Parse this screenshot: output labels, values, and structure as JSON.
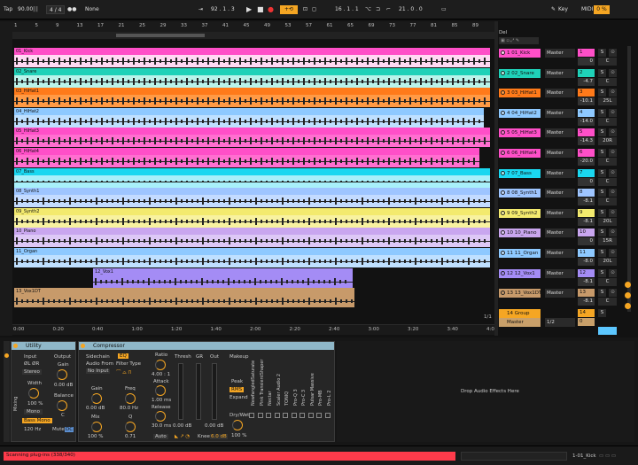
{
  "transport": {
    "tap": "Tap",
    "tempo": "90.00",
    "sig": "4 / 4",
    "metro": "●●",
    "none": "None",
    "pos": "92 .  1 .  3",
    "loop_start": "16 .  1 .  1",
    "loop_len": "21 .  0 .  0",
    "key": "Key",
    "midi": "MIDI",
    "cpu": "0 %"
  },
  "ruler": {
    "bars": [
      "1",
      "5",
      "9",
      "13",
      "17",
      "21",
      "25",
      "29",
      "33",
      "37",
      "41",
      "45",
      "49",
      "53",
      "57",
      "61",
      "65",
      "69",
      "73",
      "77",
      "81",
      "85",
      "89"
    ],
    "times": [
      "0:00",
      "0:20",
      "0:40",
      "1:00",
      "1:20",
      "1:40",
      "2:00",
      "2:20",
      "2:40",
      "3:00",
      "3:20",
      "3:40",
      "4:00"
    ],
    "page": "1/1"
  },
  "tracks": [
    {
      "name": "01_Kick",
      "mix": "1 01_Kick",
      "num": "1",
      "vol": "0",
      "pan": "C",
      "color": "#ff4fc8",
      "light": "#ffd9f3"
    },
    {
      "name": "02_Snare",
      "mix": "2 02_Snare",
      "num": "2",
      "vol": "-4.7",
      "pan": "C",
      "color": "#1fd1b8",
      "light": "#b9f3ea"
    },
    {
      "name": "03_HiHat1",
      "mix": "3 03_HiHat1",
      "num": "3",
      "vol": "-10.1",
      "pan": "25L",
      "color": "#ff7a1a",
      "light": "#ff9a45"
    },
    {
      "name": "04_HiHat2",
      "mix": "4 04_HiHat2",
      "num": "4",
      "vol": "-14.0",
      "pan": "C",
      "color": "#8ec9ff",
      "light": "#bfe0ff"
    },
    {
      "name": "05_HiHat3",
      "mix": "5 05_HiHat3",
      "num": "5",
      "vol": "-14.3",
      "pan": "20R",
      "color": "#ff4fc8",
      "light": "#ff6fd0"
    },
    {
      "name": "06_HiHat4",
      "mix": "6 06_HiHat4",
      "num": "6",
      "vol": "-20.0",
      "pan": "C",
      "color": "#ff4fc8",
      "light": "#ff6fd0"
    },
    {
      "name": "07_Bass",
      "mix": "7 07_Bass",
      "num": "7",
      "vol": "0",
      "pan": "C",
      "color": "#1ad7f0",
      "light": "#a8f0fa"
    },
    {
      "name": "08_Synth1",
      "mix": "8 08_Synth1",
      "num": "8",
      "vol": "-8.1",
      "pan": "C",
      "color": "#9ec5ff",
      "light": "#c3dbff"
    },
    {
      "name": "09_Synth2",
      "mix": "9 09_Synth2",
      "num": "9",
      "vol": "-8.1",
      "pan": "20L",
      "color": "#f3ea6e",
      "light": "#f8f2a0"
    },
    {
      "name": "10_Piano",
      "mix": "10 10_Piano",
      "num": "10",
      "vol": "0",
      "pan": "15R",
      "color": "#c9a6ef",
      "light": "#ddc8f6"
    },
    {
      "name": "11_Organ",
      "mix": "11 11_Organ",
      "num": "11",
      "vol": "-8.0",
      "pan": "20L",
      "color": "#8ec9ff",
      "light": "#bfe0ff"
    },
    {
      "name": "12_Vox1",
      "mix": "12 12_Vox1",
      "num": "12",
      "vol": "-8.1",
      "pan": "C",
      "color": "#a48cf5",
      "light": "#a48cf5"
    },
    {
      "name": "13_Vox1DT",
      "mix": "13 13_Vox1DT",
      "num": "13",
      "vol": "-8.1",
      "pan": "C",
      "color": "#c79a6a",
      "light": "#c79a6a"
    }
  ],
  "group": {
    "mix": "14 Group",
    "num": "14",
    "color": "#f5a623"
  },
  "master": {
    "mix": "Master",
    "out": "1/2",
    "num": "0"
  },
  "outputs": "Master",
  "del_label": "Del",
  "utility": {
    "title": "Utility",
    "input": "Input",
    "output": "Output",
    "phase": "ØL  ØR",
    "stereo": "Stereo",
    "width": "Width",
    "width_val": "100 %",
    "mono": "Mono",
    "bass_mono": "Bass Mono",
    "freq": "120 Hz",
    "gain": "Gain",
    "gain_val": "0.00 dB",
    "balance": "Balance",
    "bal_val": "C",
    "mute": "Mute",
    "dc": "DC",
    "mixing": "Mixing"
  },
  "compressor": {
    "title": "Compressor",
    "sidechain": "Sidechain",
    "eq": "EQ",
    "audio_from": "Audio From",
    "no_input": "No Input",
    "filter_type": "Filter Type",
    "gain": "Gain",
    "gain_val": "0.00 dB",
    "freq": "Freq",
    "freq_val": "80.0 Hz",
    "mix": "Mix",
    "mix_val": "100 %",
    "q": "Q",
    "q_val": "0.71",
    "ratio": "Ratio",
    "ratio_val": "4.00 : 1",
    "attack": "Attack",
    "attack_val": "1.00 ms",
    "release": "Release",
    "release_val": "30.0 ms",
    "auto": "Auto",
    "thresh": "Thresh",
    "gr": "GR",
    "out": "Out",
    "thresh_val": "0.00 dB",
    "out_val": "0.00 dB",
    "knee": "Knee",
    "knee_val": "6.0 dB",
    "makeup": "Makeup",
    "peak": "Peak",
    "rms": "RMS",
    "expand": "Expand",
    "drywet": "Dry/Wet",
    "drywet_val": "100 %"
  },
  "plugins": [
    "NewfangledSaturate",
    "Pink TransientShaper",
    "Nectar",
    "Scaler Audio 2",
    "TONIQ",
    "Pro-Q 3",
    "Pro-C 3",
    "Pulsar Massive",
    "Pro-MB",
    "Pro-L 2"
  ],
  "drop_text": "Drop Audio Effects Here",
  "status": {
    "text": "Scanning plug-ins (338/340)",
    "clip": "1-01_Kick"
  }
}
